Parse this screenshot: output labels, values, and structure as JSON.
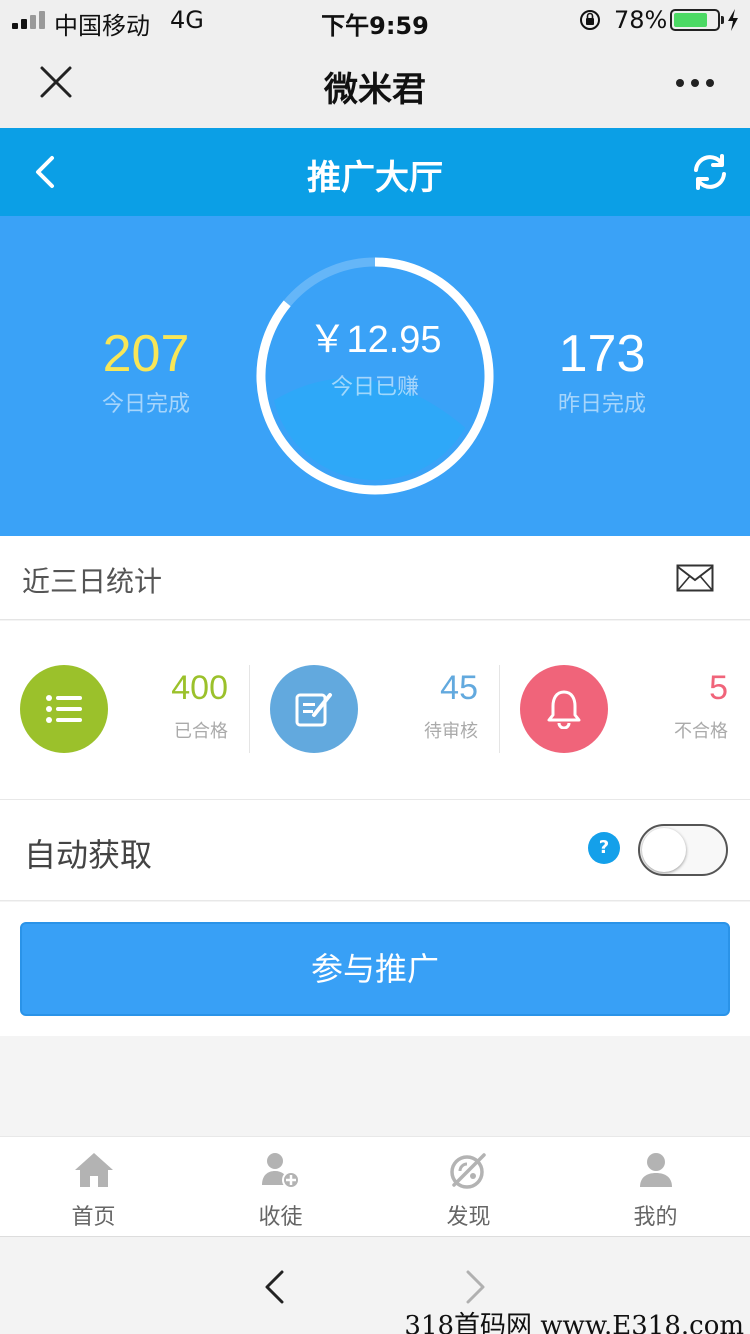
{
  "status_bar": {
    "carrier": "中国移动",
    "network": "4G",
    "time": "下午9:59",
    "battery_percent": "78%",
    "battery_level": 0.78
  },
  "wechat_bar": {
    "title": "微米君",
    "close_icon": "close-icon",
    "more_icon": "more-icon"
  },
  "app_header": {
    "title": "推广大厅",
    "back_icon": "chevron-left-icon",
    "refresh_icon": "refresh-icon",
    "color": "#0b9fe6"
  },
  "hero": {
    "today_count": "207",
    "today_label": "今日完成",
    "earnings": "￥12.95",
    "earnings_label": "今日已赚",
    "yesterday_count": "173",
    "yesterday_label": "昨日完成",
    "ring_progress": 0.86
  },
  "stats_section": {
    "title": "近三日统计",
    "mail_icon": "mail-icon",
    "items": [
      {
        "value": "400",
        "label": "已合格",
        "icon": "list-icon",
        "color": "#9bc12b"
      },
      {
        "value": "45",
        "label": "待审核",
        "icon": "edit-icon",
        "color": "#62a9de"
      },
      {
        "value": "5",
        "label": "不合格",
        "icon": "bell-icon",
        "color": "#f0647a"
      }
    ]
  },
  "auto_fetch": {
    "label": "自动获取",
    "help": "?",
    "enabled": false
  },
  "cta": {
    "label": "参与推广"
  },
  "tabbar": {
    "items": [
      {
        "label": "首页",
        "icon": "home-icon"
      },
      {
        "label": "收徒",
        "icon": "add-user-icon"
      },
      {
        "label": "发现",
        "icon": "discover-icon"
      },
      {
        "label": "我的",
        "icon": "profile-icon"
      }
    ]
  },
  "watermark": "318首码网 www.E318.com"
}
